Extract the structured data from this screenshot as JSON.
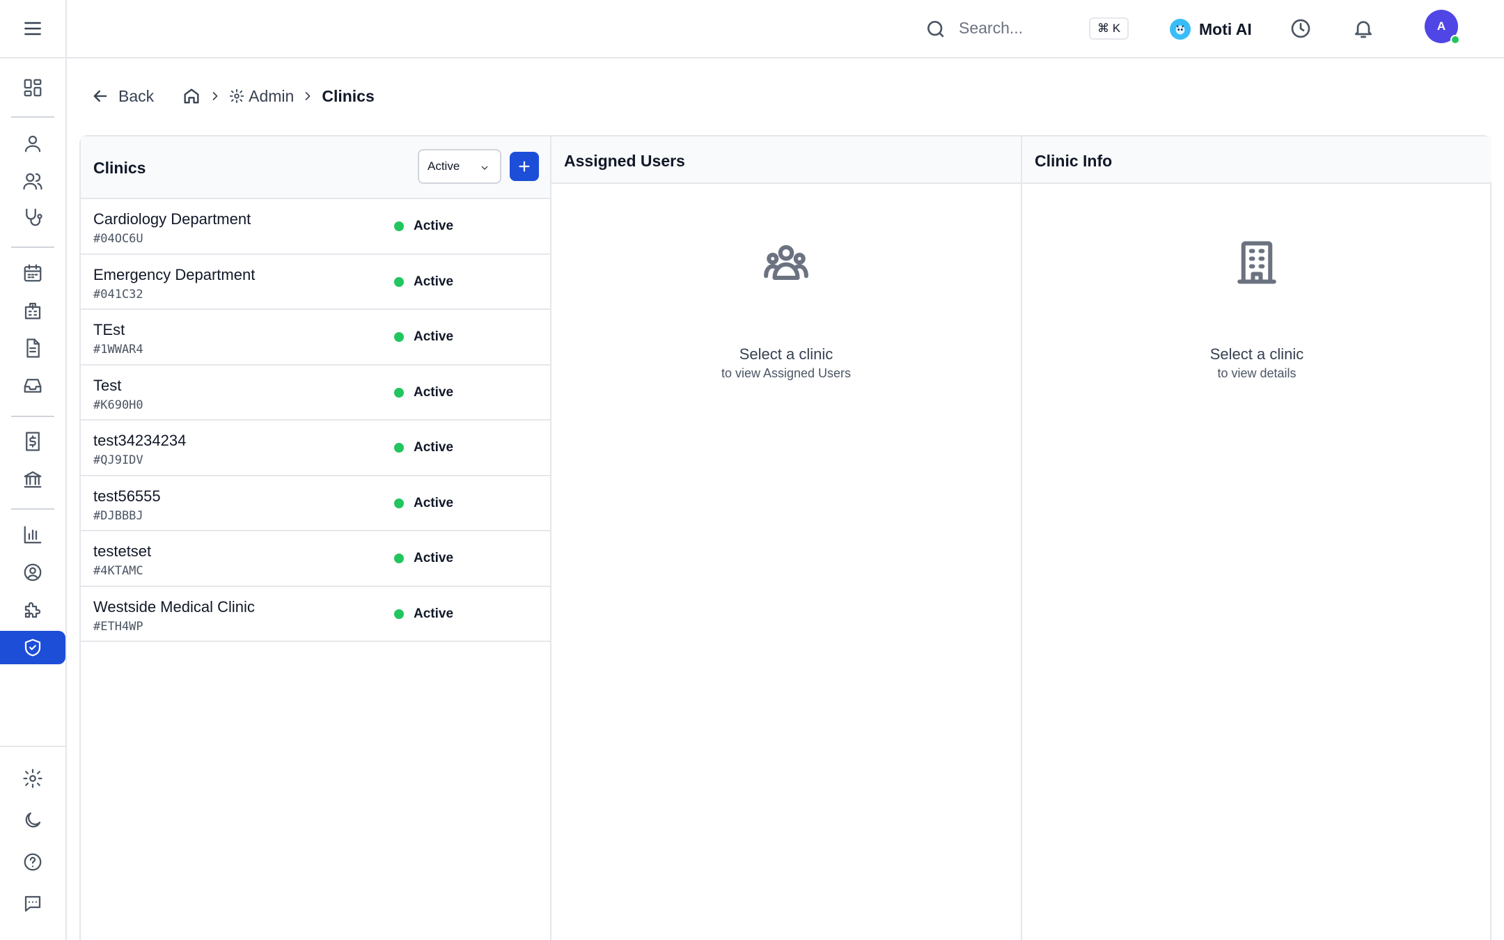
{
  "header": {
    "search_placeholder": "Search...",
    "shortcut": "⌘ K",
    "assistant_label": "Moti AI",
    "avatar_initial": "A"
  },
  "breadcrumb": {
    "back_label": "Back",
    "admin_label": "Admin",
    "current_label": "Clinics"
  },
  "clinics_panel": {
    "title": "Clinics",
    "filter_value": "Active",
    "items": [
      {
        "name": "Cardiology Department",
        "id": "#04OC6U",
        "status": "Active"
      },
      {
        "name": "Emergency Department",
        "id": "#041C32",
        "status": "Active"
      },
      {
        "name": "TEst",
        "id": "#1WWAR4",
        "status": "Active"
      },
      {
        "name": "Test",
        "id": "#K690H0",
        "status": "Active"
      },
      {
        "name": "test34234234",
        "id": "#QJ9IDV",
        "status": "Active"
      },
      {
        "name": "test56555",
        "id": "#DJBBBJ",
        "status": "Active"
      },
      {
        "name": "testetset",
        "id": "#4KTAMC",
        "status": "Active"
      },
      {
        "name": "Westside Medical Clinic",
        "id": "#ETH4WP",
        "status": "Active"
      }
    ]
  },
  "assigned_panel": {
    "title": "Assigned Users",
    "empty_title": "Select a clinic",
    "empty_sub": "to view Assigned Users"
  },
  "info_panel": {
    "title": "Clinic Info",
    "empty_title": "Select a clinic",
    "empty_sub": "to view details"
  },
  "colors": {
    "accent": "#1d4ed8",
    "status_active": "#22c55e"
  }
}
